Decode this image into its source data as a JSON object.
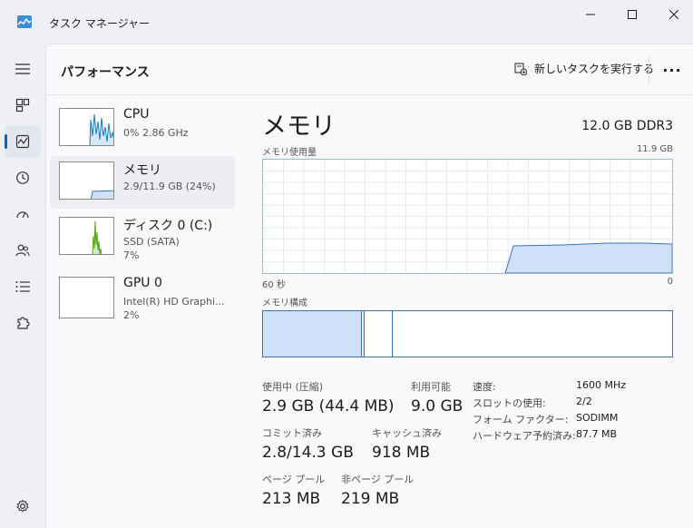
{
  "window": {
    "title": "タスク マネージャー"
  },
  "header": {
    "title": "パフォーマンス",
    "new_task_label": "新しいタスクを実行する",
    "more_label": "···"
  },
  "devices": [
    {
      "name": "CPU",
      "line1": "0%  2.86 GHz",
      "line2": ""
    },
    {
      "name": "メモリ",
      "line1": "2.9/11.9 GB (24%)",
      "line2": ""
    },
    {
      "name": "ディスク 0 (C:)",
      "line1": "SSD (SATA)",
      "line2": "7%"
    },
    {
      "name": "GPU 0",
      "line1": "Intel(R) HD Graphi...",
      "line2": "2%"
    }
  ],
  "detail": {
    "title": "メモリ",
    "spec": "12.0 GB DDR3",
    "usage_label": "メモリ使用量",
    "usage_max": "11.9 GB",
    "axis_left": "60 秒",
    "axis_right": "0",
    "composition_label": "メモリ構成"
  },
  "stats": {
    "in_use_label": "使用中 (圧縮)",
    "in_use_value": "2.9 GB (44.4 MB)",
    "available_label": "利用可能",
    "available_value": "9.0 GB",
    "committed_label": "コミット済み",
    "committed_value": "2.8/14.3 GB",
    "cached_label": "キャッシュ済み",
    "cached_value": "918 MB",
    "paged_label": "ページ プール",
    "paged_value": "213 MB",
    "nonpaged_label": "非ページ プール",
    "nonpaged_value": "219 MB"
  },
  "properties": [
    {
      "label": "速度:",
      "value": "1600 MHz"
    },
    {
      "label": "スロットの使用:",
      "value": "2/2"
    },
    {
      "label": "フォーム ファクター:",
      "value": "SODIMM"
    },
    {
      "label": "ハードウェア予約済み:",
      "value": "87.7 MB"
    }
  ],
  "colors": {
    "accent": "#0067c0",
    "memory_fill": "#cfe0f8",
    "memory_line": "#3a74b8",
    "cpu_line": "#117dbb",
    "disk_line": "#4da60c"
  }
}
